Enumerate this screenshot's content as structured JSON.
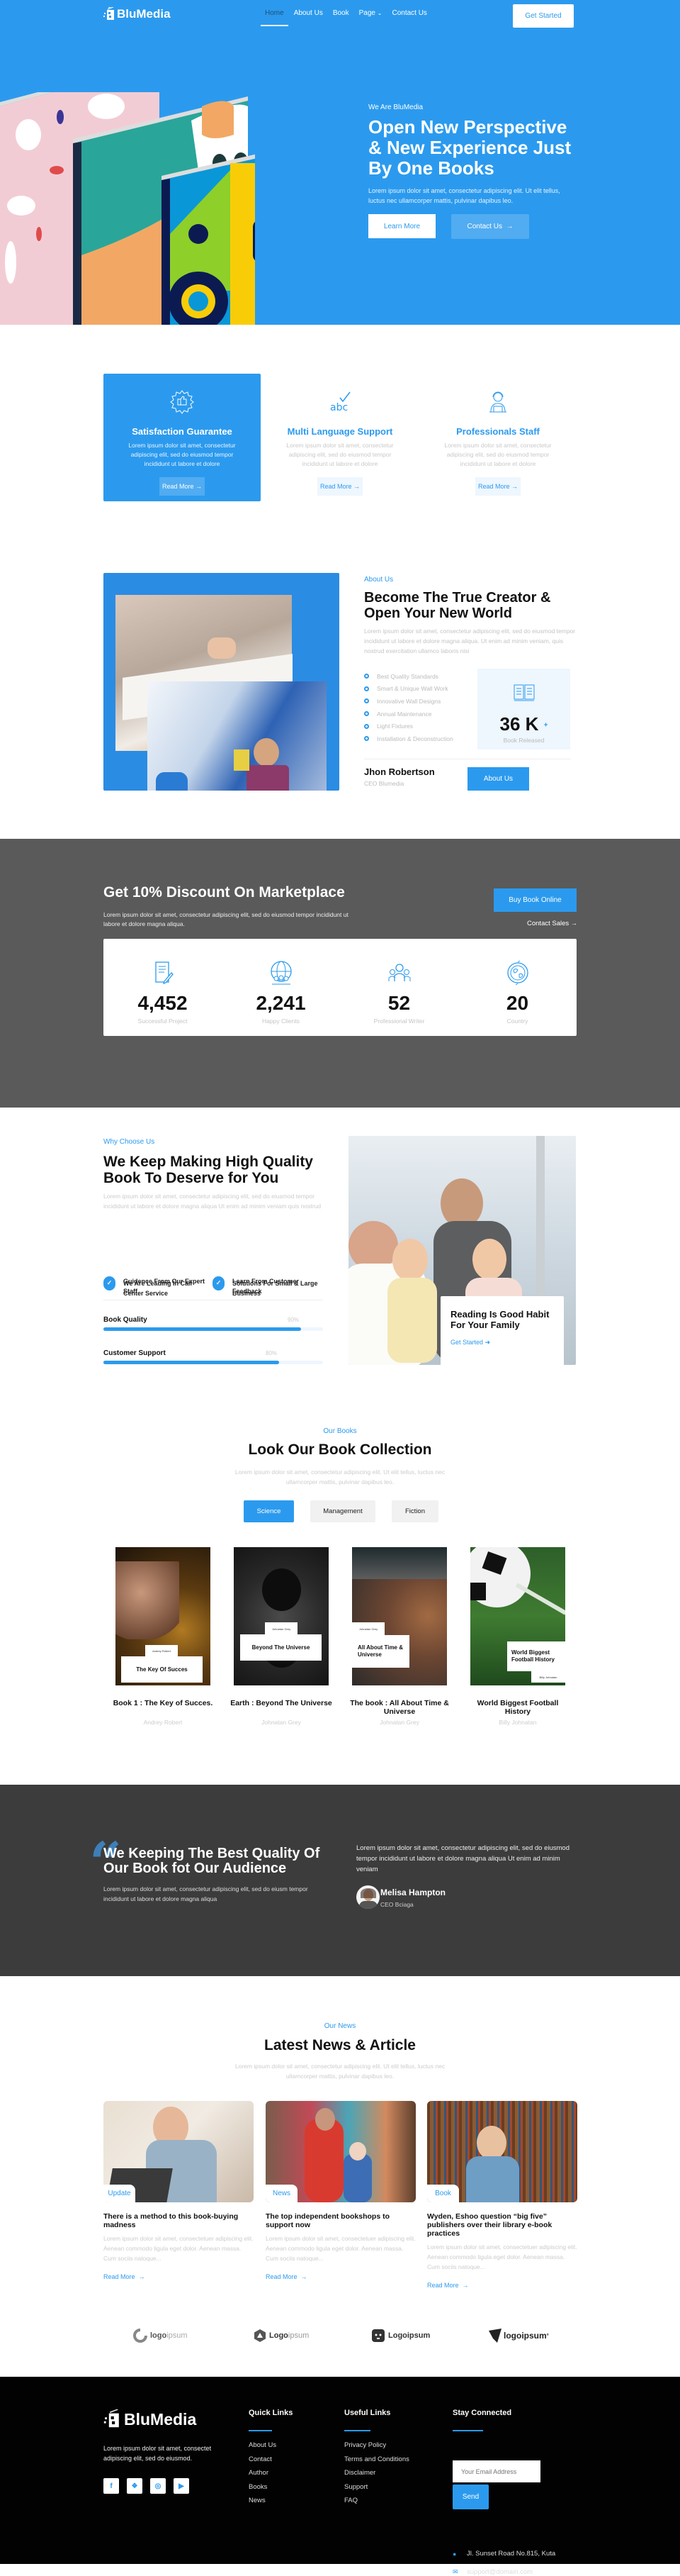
{
  "nav": {
    "brand": "BluMedia",
    "links": [
      "Home",
      "About Us",
      "Book",
      "Page",
      "Contact Us"
    ],
    "active": "Home",
    "cta": "Get Started"
  },
  "hero": {
    "subtitle": "We Are BluMedia",
    "title": "Open New Perspective & New Experience Just By One Books",
    "description": "Lorem ipsum dolor sit amet, consectetur adipiscing elit. Ut elit tellus, luctus nec ullamcorper mattis, pulvinar dapibus leo.",
    "learn_more": "Learn More",
    "contact_us": "Contact Us"
  },
  "features": [
    {
      "icon": "award-thumbs-up-icon",
      "title": "Satisfaction Guarantee",
      "text": "Lorem ipsum dolor sit amet, consectetur adipiscing elit, sed do eiusmod tempor incididunt ut labore et dolore",
      "button": "Read More",
      "active": true
    },
    {
      "icon": "abc-check-icon",
      "title": "Multi Language Support",
      "text": "Lorem ipsum dolor sit amet, consectetur adipiscing elit, sed do eiusmod tempor incididunt ut labore et dolore",
      "button": "Read More",
      "active": false
    },
    {
      "icon": "support-agent-icon",
      "title": "Professionals Staff",
      "text": "Lorem ipsum dolor sit amet, consectetur adipiscing elit, sed do eiusmod tempor incididunt ut labore et dolore",
      "button": "Read More",
      "active": false
    }
  ],
  "about": {
    "tag": "About Us",
    "title": "Become The True Creator & Open Your New World",
    "description": "Lorem ipsum dolor sit amet, consectetur adipiscing elit, sed do eiusmod tempor incididunt ut labore et dolore magna aliqua. Ut enim ad minim veniam, quis nostrud exercitation ullamco laboris nisi",
    "list": [
      "Best Quality Standards",
      "Smart & Unique Wall Work",
      "Innovative Wall Designs",
      "Annual Maintenance",
      "Light Fixtures",
      "Installation & Deconstruction"
    ],
    "stat_value": "36 K",
    "stat_suffix": "+",
    "stat_label": "Book Released",
    "person_name": "Jhon Robertson",
    "person_role": "CEO Blumedia",
    "button": "About Us"
  },
  "discount": {
    "title": "Get 10% Discount On Marketplace",
    "description": "Lorem ipsum dolor sit amet, consectetur adipiscing elit, sed do eiusmod tempor incididunt ut labore et dolore magna aliqua.",
    "button": "Buy Book Online",
    "link": "Contact Sales →",
    "stats": [
      {
        "icon": "document-pen-icon",
        "value": "4,452",
        "label": "Successful Project"
      },
      {
        "icon": "globe-people-icon",
        "value": "2,241",
        "label": "Happy Clients"
      },
      {
        "icon": "team-icon",
        "value": "52",
        "label": "Professional Writer"
      },
      {
        "icon": "earth-icon",
        "value": "20",
        "label": "Country"
      }
    ]
  },
  "why": {
    "tag": "Why Choose Us",
    "title": "We Keep Making High Quality Book To Deserve for You",
    "description": "Lorem ipsum dolor sit amet, consectetur adipiscing elit, sed do eiusmod tempor incididunt ut labore et dolore magna aliqua Ut enim ad minim veniam quis nostrud",
    "features": [
      "We Are Leading In Call Center Service",
      "Solutions For Small & Large Business",
      "Guidence From Our Expert Staff",
      "Learn From Customer Feedback"
    ],
    "bars": [
      {
        "label": "Book Quality",
        "percent": 90,
        "text": "90%"
      },
      {
        "label": "Customer Support",
        "percent": 80,
        "text": "80%"
      }
    ],
    "card_title": "Reading Is Good Habit For Your Family",
    "card_link": "Get Started"
  },
  "books": {
    "tag": "Our Books",
    "title": "Look Our Book Collection",
    "description": "Lorem ipsum dolor sit amet, consectetur adipiscing elit. Ut elit tellus, luctus nec ullamcorper mattis, pulvinar dapibus leo.",
    "tabs": [
      "Science",
      "Management",
      "Fiction"
    ],
    "active_tab": "Science",
    "items": [
      {
        "cover_title": "The Key Of Succes",
        "cover_author": "Andrey Robert",
        "title": "Book 1 : The Key of Succes.",
        "author": "Andrey Robert"
      },
      {
        "cover_title": "Beyond The Universe",
        "cover_author": "Johnatan Grey",
        "title": "Earth : Beyond The Universe",
        "author": "Johnatan Grey"
      },
      {
        "cover_title": "All About Time & Universe",
        "cover_author": "Johnatan Grey",
        "title": "The book : All About Time & Universe",
        "author": "Johnatan Grey"
      },
      {
        "cover_title": "World Biggest Football History",
        "cover_author": "Billy Johnatan",
        "title": "World Biggest Football History",
        "author": "Billy Johnatan"
      }
    ]
  },
  "testimonial": {
    "title": "We Keeping The Best Quality Of Our Book fot Our Audience",
    "description": "Lorem ipsum dolor sit amet, consectetur adipiscing elit, sed do eiusm tempor incididunt ut labore et dolore magna aliqua",
    "quote": "Lorem ipsum dolor sit amet, consectetur adipiscing elit, sed do eiusmod tempor incididunt ut labore et dolore magna aliqua Ut enim ad minim veniam",
    "name": "Melisa Hampton",
    "role": "CEO Bciaga"
  },
  "news": {
    "tag": "Our News",
    "title": "Latest News & Article",
    "description": "Lorem ipsum dolor sit amet, consectetur adipiscing elit. Ut elit tellus, luctus nec ullamcorper mattis, pulvinar dapibus leo.",
    "items": [
      {
        "category": "Update",
        "title": "There is a method to this book-buying madness",
        "excerpt": "Lorem ipsum dolor sit amet, consectetuer adipiscing elit. Aenean commodo ligula eget dolor. Aenean massa. Cum sociis natoque...",
        "link": "Read More"
      },
      {
        "category": "News",
        "title": "The top independent bookshops to support now",
        "excerpt": "Lorem ipsum dolor sit amet, consectetuer adipiscing elit. Aenean commodo ligula eget dolor. Aenean massa. Cum sociis natoque...",
        "link": "Read More"
      },
      {
        "category": "Book",
        "title": "Wyden, Eshoo question “big five” publishers over their library e-book practices",
        "excerpt": "Lorem ipsum dolor sit amet, consectetuer adipiscing elit. Aenean commodo ligula eget dolor. Aenean massa. Cum sociis natoque...",
        "link": "Read More"
      }
    ]
  },
  "partners": [
    {
      "prefix": "logo",
      "suffix": "ipsum"
    },
    {
      "prefix": "Logo",
      "suffix": "ipsum"
    },
    {
      "prefix": "Logoipsum",
      "suffix": ""
    },
    {
      "prefix": "logoipsum",
      "suffix": "°"
    }
  ],
  "footer": {
    "brand": "BluMedia",
    "description": "Lorem ipsum dolor sit amet, consectet adipiscing elit, sed do eiusmod.",
    "social": [
      "facebook-icon",
      "twitter-icon",
      "instagram-icon",
      "youtube-icon"
    ],
    "quick_links_title": "Quick Links",
    "quick_links": [
      "About Us",
      "Contact",
      "Author",
      "Books",
      "News"
    ],
    "useful_links_title": "Useful Links",
    "useful_links": [
      "Privacy Policy",
      "Terms and Conditions",
      "Disclaimer",
      "Support",
      "FAQ"
    ],
    "stay_title": "Stay Connected",
    "email_placeholder": "Your Email Address",
    "send": "Send",
    "address": "Jl. Sunset Road No.815, Kuta",
    "email": "support@domain.com"
  },
  "colors": {
    "primary": "#2B9AEE",
    "discount_bg": "#5A5A5A",
    "testimonial_bg": "#3C3C3C",
    "footer_bg": "#020202"
  }
}
